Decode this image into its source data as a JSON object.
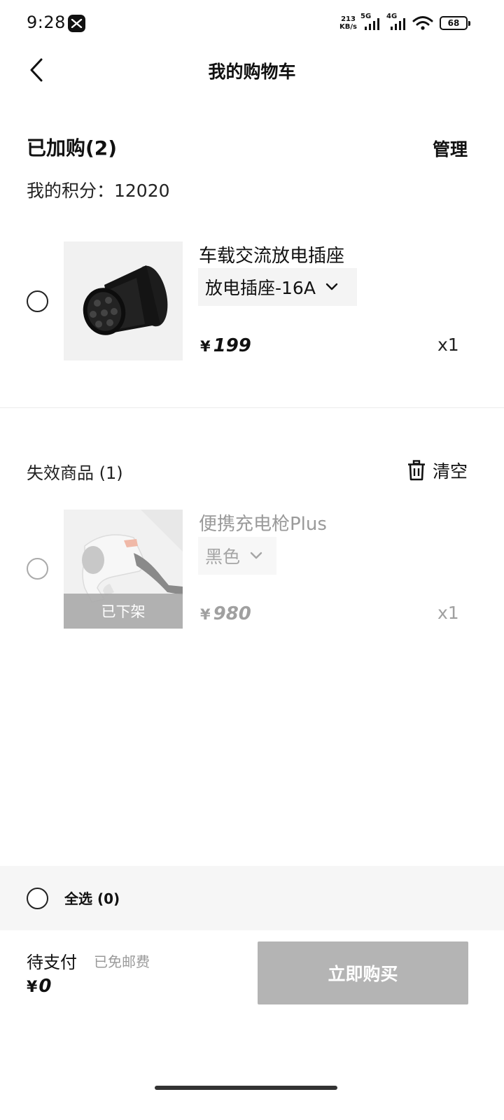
{
  "status_bar": {
    "time": "9:28",
    "net_speed_value": "213",
    "net_speed_unit": "KB/s",
    "signal_1_label": "5G",
    "signal_2_label": "4G",
    "battery": "68",
    "app_icon": "x-badge-icon"
  },
  "header": {
    "title": "我的购物车",
    "back_icon": "chevron-left-icon"
  },
  "cart": {
    "added_title": "已加购(2)",
    "manage_label": "管理",
    "points_label": "我的积分：12020",
    "items": [
      {
        "name": "车载交流放电插座",
        "spec": "放电插座-16A",
        "currency": "¥",
        "price": "199",
        "qty": "x1",
        "image": "discharge-socket-image"
      }
    ]
  },
  "invalid": {
    "title": "失效商品 (1)",
    "clear_label": "清空",
    "clear_icon": "trash-icon",
    "items": [
      {
        "name": "便携充电枪Plus",
        "spec": "黑色",
        "currency": "¥",
        "price": "980",
        "qty": "x1",
        "status": "已下架",
        "image": "charging-gun-image"
      }
    ]
  },
  "footer": {
    "select_all_label": "全选 (0)",
    "pay_label": "待支付",
    "shipping_note": "已免邮费",
    "total_currency": "¥",
    "total_value": "0",
    "buy_label": "立即购买"
  },
  "colors": {
    "disabled_button": "#b4b4b4",
    "select_bar_bg": "#f6f6f6",
    "text_primary": "#111111",
    "text_disabled": "#9a9a9a"
  }
}
